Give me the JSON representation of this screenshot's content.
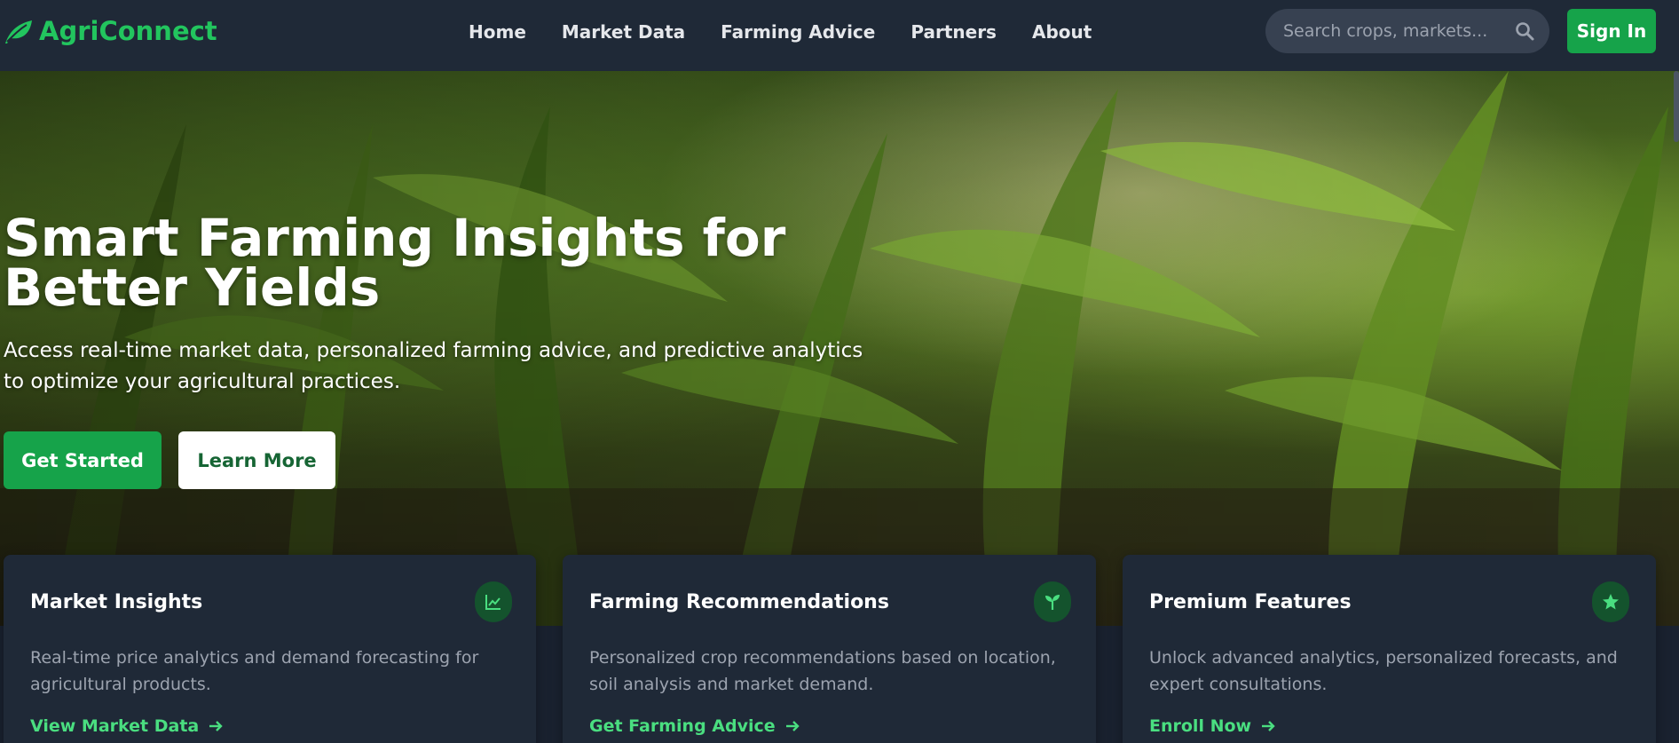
{
  "nav": {
    "brand": "AgriConnect",
    "links": [
      "Home",
      "Market Data",
      "Farming Advice",
      "Partners",
      "About"
    ],
    "search_placeholder": "Search crops, markets...",
    "signin_label": "Sign In"
  },
  "hero": {
    "title": "Smart Farming Insights for Better Yields",
    "subtitle": "Access real-time market data, personalized farming advice, and predictive analytics to optimize your agricultural practices.",
    "primary_label": "Get Started",
    "secondary_label": "Learn More"
  },
  "cards": [
    {
      "title": "Market Insights",
      "icon": "chart-line-icon",
      "description": "Real-time price analytics and demand forecasting for agricultural products.",
      "link": "View Market Data"
    },
    {
      "title": "Farming Recommendations",
      "icon": "seedling-icon",
      "description": "Personalized crop recommendations based on location, soil analysis and market demand.",
      "link": "Get Farming Advice"
    },
    {
      "title": "Premium Features",
      "icon": "star-icon",
      "description": "Unlock advanced analytics, personalized forecasts, and expert consultations.",
      "link": "Enroll Now"
    }
  ],
  "colors": {
    "brand_green": "#22c55e",
    "button_green": "#16a34a",
    "link_green": "#4ade80",
    "nav_bg": "#1f2937"
  }
}
